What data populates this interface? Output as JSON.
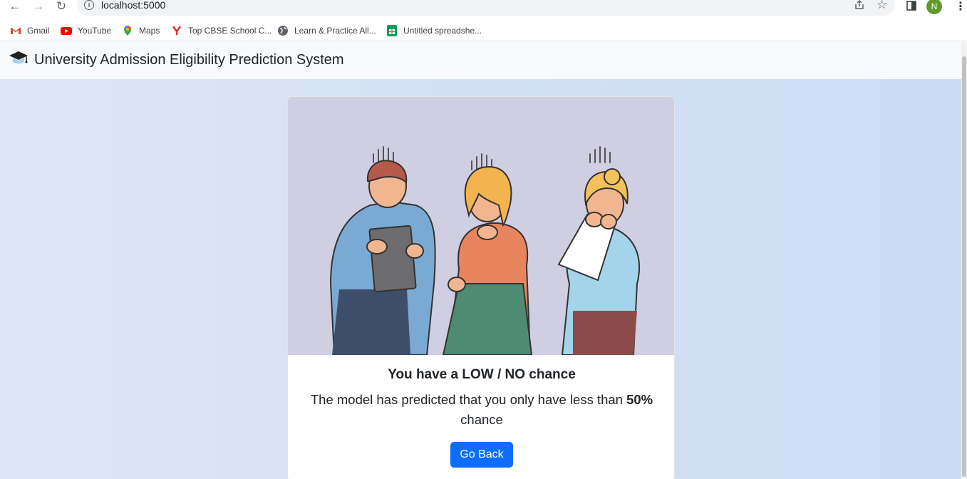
{
  "browser": {
    "url": "localhost:5000",
    "profile_initial": "N",
    "bookmarks": [
      {
        "label": "Gmail"
      },
      {
        "label": "YouTube"
      },
      {
        "label": "Maps"
      },
      {
        "label": "Top CBSE School C..."
      },
      {
        "label": "Learn & Practice All..."
      },
      {
        "label": "Untitled spreadshe..."
      }
    ]
  },
  "navbar": {
    "title": "University Admission Eligibility Prediction System",
    "logo_icon": "graduation-cap-icon"
  },
  "result": {
    "heading": "You have a LOW / NO chance",
    "message_prefix": "The model has predicted that you only have less than",
    "message_percent": "50%",
    "message_suffix": "chance",
    "button_label": "Go Back",
    "image_icon": "worried-students-illustration"
  },
  "colors": {
    "primary": "#0d6efd",
    "navbar_bg": "#f8f9fa",
    "page_bg": "#d6e2f6",
    "illustration_bg": "#d0cee1"
  }
}
